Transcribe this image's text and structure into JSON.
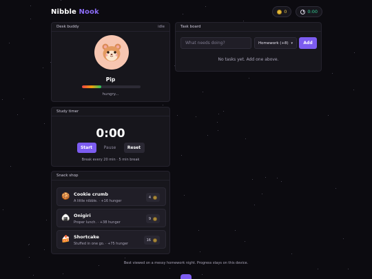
{
  "app": {
    "title_part1": "Nibble",
    "title_part2": "Nook"
  },
  "header": {
    "coins": "0",
    "timer": "0:00",
    "coin_icon": "coin-icon",
    "timer_icon": "clock-icon"
  },
  "buddy": {
    "title": "Desk buddy",
    "status": "idle",
    "pet_name": "Pip",
    "mood": "hungry...",
    "hunger_level": 0.33,
    "avatar": "hamster-face"
  },
  "timer": {
    "title": "Study timer",
    "display": "0:00",
    "start_label": "Start",
    "pause_label": "Pause",
    "reset_label": "Reset",
    "note": "Break every 20 min · 5 min break"
  },
  "shop": {
    "title": "Snack shop",
    "items": [
      {
        "icon": "🍪",
        "name": "Cookie crumb",
        "desc": "A little nibble. · +16 hunger",
        "price": "4"
      },
      {
        "icon": "🍙",
        "name": "Onigiri",
        "desc": "Proper lunch. · +38 hunger",
        "price": "9"
      },
      {
        "icon": "🍰",
        "name": "Shortcake",
        "desc": "Stuffed in one go. · +75 hunger",
        "price": "16"
      }
    ]
  },
  "tasks": {
    "title": "Task board",
    "input_placeholder": "What needs doing?",
    "category": "Homework (+8)",
    "add_label": "Add",
    "empty": "No tasks yet. Add one above."
  },
  "footer": {
    "text": "Best viewed on a messy homework night. Progress stays on this device."
  },
  "colors": {
    "accent": "#7c5cf0",
    "background": "#0c0b10",
    "card": "#17161c",
    "coin": "#e2b93b",
    "timer_green": "#34d399"
  }
}
